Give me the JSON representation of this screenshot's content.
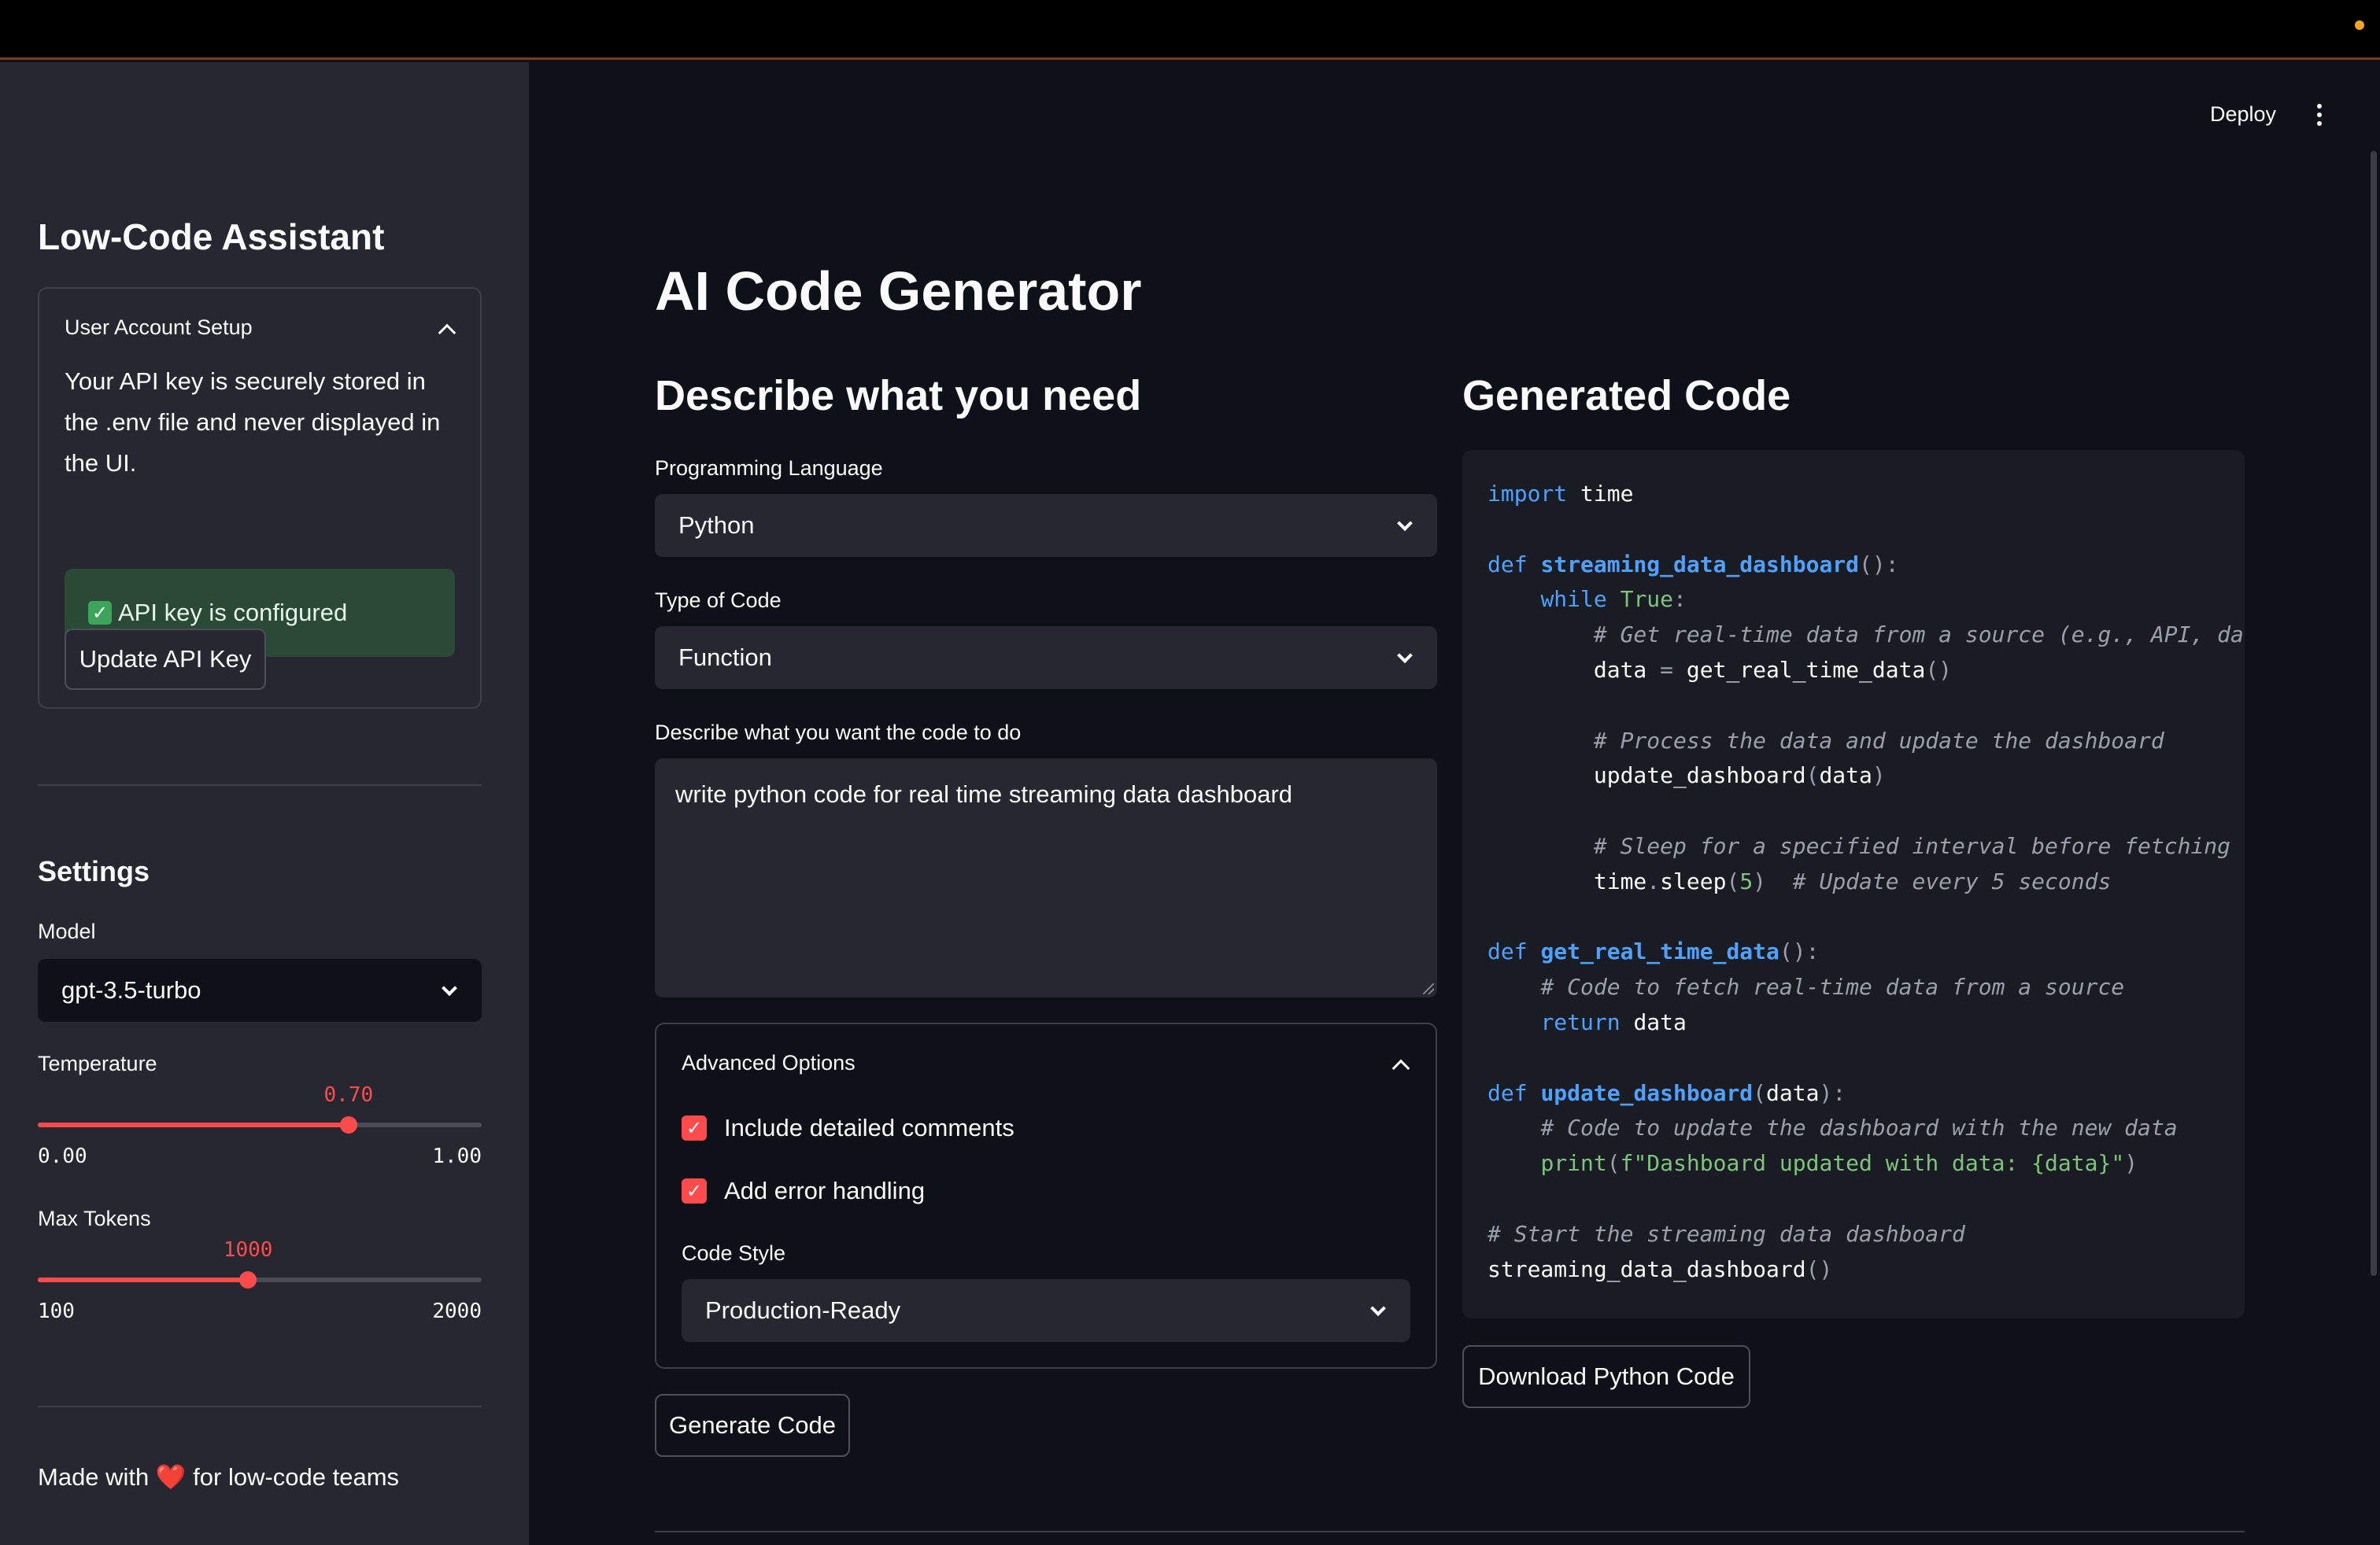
{
  "colors": {
    "accent": "#ff4b4b",
    "sidebar_bg": "#262730",
    "main_bg": "#0e1117",
    "success_bg": "#2b4a35"
  },
  "sidebar": {
    "title": "Low-Code Assistant",
    "account": {
      "header": "User Account Setup",
      "info": "Your API key is securely stored in the .env file and never displayed in the UI.",
      "status": "API key is configured",
      "update_button": "Update API Key"
    },
    "settings": {
      "title": "Settings",
      "model_label": "Model",
      "model_value": "gpt-3.5-turbo",
      "temperature": {
        "label": "Temperature",
        "value": "0.70",
        "min": "0.00",
        "max": "1.00",
        "fraction": 0.7
      },
      "max_tokens": {
        "label": "Max Tokens",
        "value": "1000",
        "min": "100",
        "max": "2000",
        "fraction": 0.4737
      }
    },
    "footer": {
      "prefix": "Made with",
      "heart": "❤️",
      "suffix": "for low-code teams"
    }
  },
  "header": {
    "deploy_label": "Deploy"
  },
  "main": {
    "title": "AI Code Generator",
    "describe_heading": "Describe what you need",
    "language": {
      "label": "Programming Language",
      "value": "Python"
    },
    "code_type": {
      "label": "Type of Code",
      "value": "Function"
    },
    "description": {
      "label": "Describe what you want the code to do",
      "value": "write python code for real time streaming data dashboard"
    },
    "advanced": {
      "header": "Advanced Options",
      "comments_label": "Include detailed comments",
      "comments_checked": true,
      "error_label": "Add error handling",
      "error_checked": true,
      "style_label": "Code Style",
      "style_value": "Production-Ready"
    },
    "generate_button": "Generate Code",
    "output": {
      "heading": "Generated Code",
      "language": "python",
      "download_button": "Download Python Code",
      "code_lines": [
        "import time",
        "",
        "def streaming_data_dashboard():",
        "    while True:",
        "        # Get real-time data from a source (e.g., API, da",
        "        data = get_real_time_data()",
        "",
        "        # Process the data and update the dashboard",
        "        update_dashboard(data)",
        "",
        "        # Sleep for a specified interval before fetching n",
        "        time.sleep(5)  # Update every 5 seconds",
        "",
        "def get_real_time_data():",
        "    # Code to fetch real-time data from a source",
        "    return data",
        "",
        "def update_dashboard(data):",
        "    # Code to update the dashboard with the new data",
        "    print(f\"Dashboard updated with data: {data}\")",
        "",
        "# Start the streaming data dashboard",
        "streaming_data_dashboard()"
      ]
    }
  }
}
